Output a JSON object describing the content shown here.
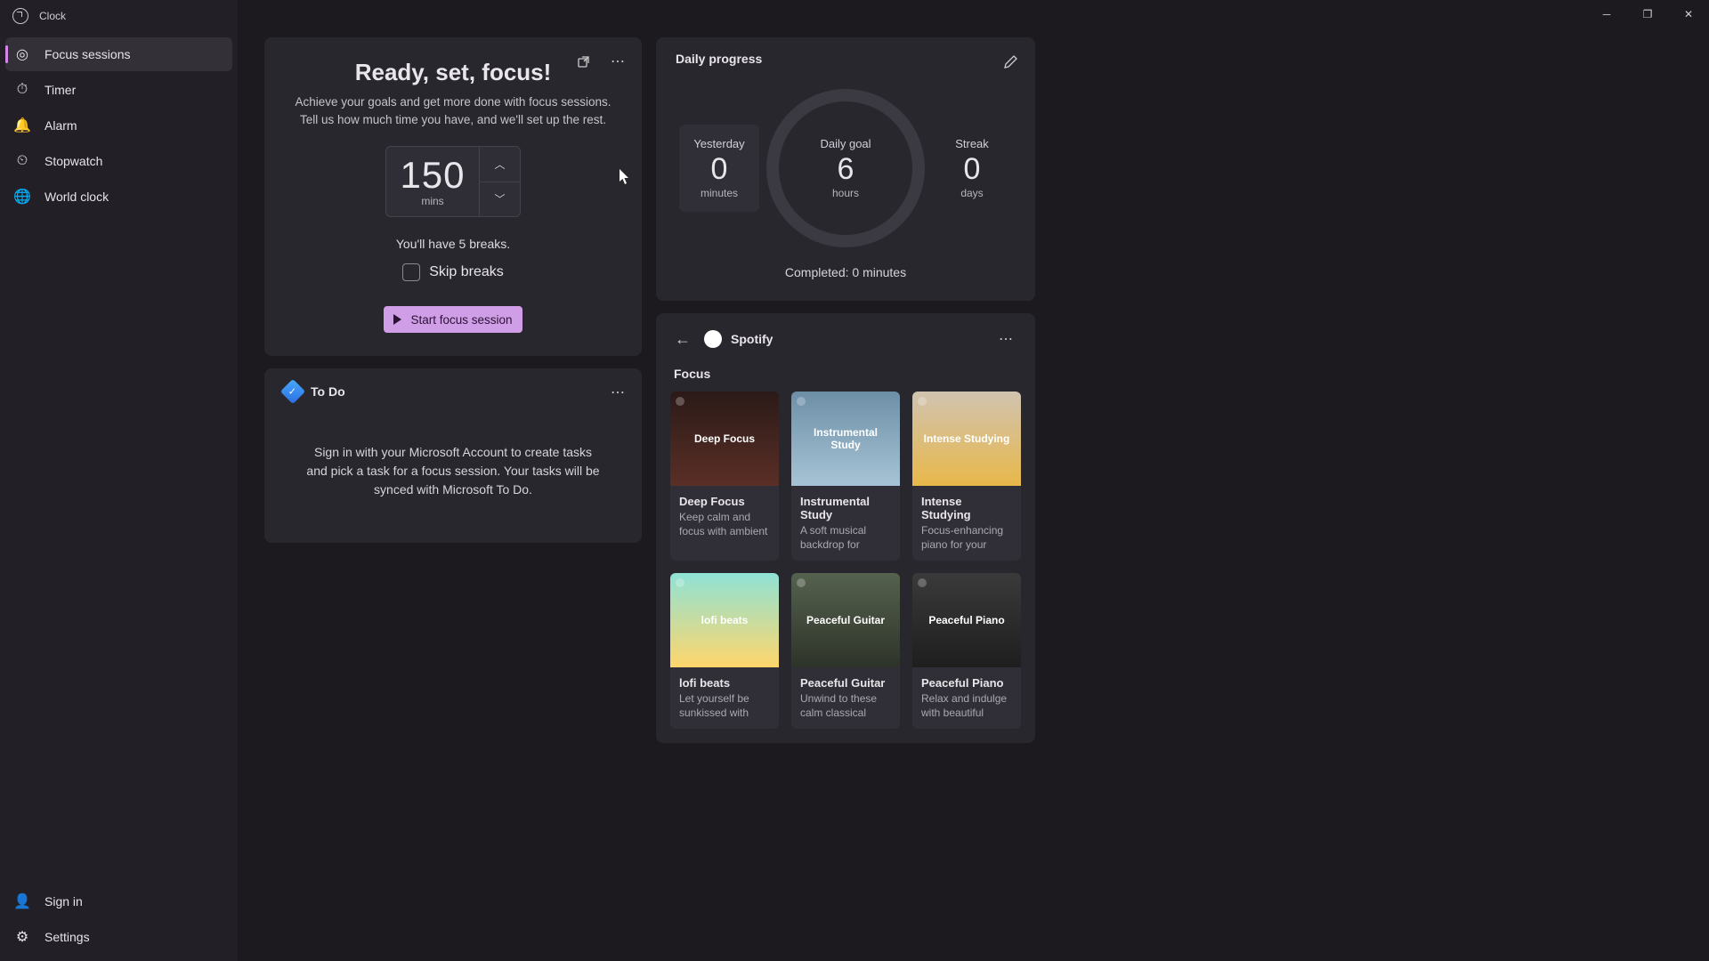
{
  "app": {
    "title": "Clock"
  },
  "nav": {
    "items": [
      {
        "label": "Focus sessions"
      },
      {
        "label": "Timer"
      },
      {
        "label": "Alarm"
      },
      {
        "label": "Stopwatch"
      },
      {
        "label": "World clock"
      }
    ],
    "signin": "Sign in",
    "settings": "Settings"
  },
  "focus": {
    "title": "Ready, set, focus!",
    "subtitle": "Achieve your goals and get more done with focus sessions. Tell us how much time you have, and we'll set up the rest.",
    "duration_value": "150",
    "duration_unit": "mins",
    "breaks_text": "You'll have 5 breaks.",
    "skip_label": "Skip breaks",
    "start_label": "Start focus session"
  },
  "todo": {
    "title": "To Do",
    "body": "Sign in with your Microsoft Account to create tasks and pick a task for a focus session. Your tasks will be synced with Microsoft To Do."
  },
  "daily": {
    "title": "Daily progress",
    "yesterday_label": "Yesterday",
    "yesterday_val": "0",
    "yesterday_unit": "minutes",
    "goal_label": "Daily goal",
    "goal_val": "6",
    "goal_unit": "hours",
    "streak_label": "Streak",
    "streak_val": "0",
    "streak_unit": "days",
    "completed": "Completed: 0 minutes"
  },
  "spotify": {
    "name": "Spotify",
    "section": "Focus",
    "playlists": [
      {
        "title": "Deep Focus",
        "desc": "Keep calm and focus with ambient and...",
        "cover_text": "Deep Focus",
        "cover_bg": "linear-gradient(#2b1a18,#5a2f26)"
      },
      {
        "title": "Instrumental Study",
        "desc": "A soft musical backdrop for your...",
        "cover_text": "Instrumental Study",
        "cover_bg": "linear-gradient(#6d8fa6,#a7c4d6)"
      },
      {
        "title": "Intense Studying",
        "desc": "Focus-enhancing piano for your stu...",
        "cover_text": "Intense Studying",
        "cover_bg": "linear-gradient(#d0c3b0,#e8b84a)"
      },
      {
        "title": "lofi beats",
        "desc": "Let yourself be sunkissed with bea...",
        "cover_text": "lofi beats",
        "cover_bg": "linear-gradient(#8fe2d6,#ffd66b)"
      },
      {
        "title": "Peaceful Guitar",
        "desc": "Unwind to these calm classical guit...",
        "cover_text": "Peaceful Guitar",
        "cover_bg": "linear-gradient(#55624e,#2e3329)"
      },
      {
        "title": "Peaceful Piano",
        "desc": "Relax and indulge with beautiful pian...",
        "cover_text": "Peaceful Piano",
        "cover_bg": "linear-gradient(#3a3a3a,#1e1e1e)"
      }
    ]
  }
}
